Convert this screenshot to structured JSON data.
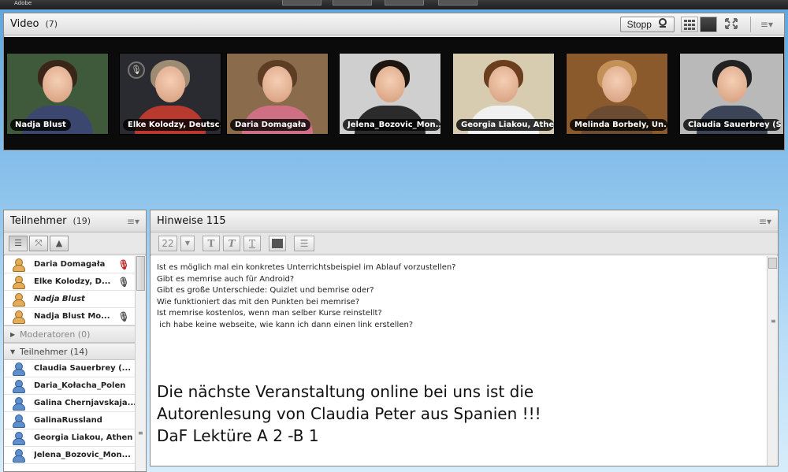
{
  "app": {
    "logo_text": "Adobe"
  },
  "video_pod": {
    "title": "Video",
    "count": "(7)",
    "stop_label": "Stopp",
    "tiles": [
      {
        "name": "Nadja Blust",
        "bg": "#3f5a3b",
        "hair": "#3a2619",
        "body": "#3c4770"
      },
      {
        "name": "Elke Kolodzy, Deutsc...",
        "bg": "#2a2b30",
        "hair": "#9d8c73",
        "body": "#b83a2e"
      },
      {
        "name": "Daria Domagała",
        "bg": "#8a6b4c",
        "hair": "#5e3d25",
        "body": "#cf6f83"
      },
      {
        "name": "Jelena_Bozovic_Mon...",
        "bg": "#cfcfcf",
        "hair": "#1d1510",
        "body": "#2b2b2b"
      },
      {
        "name": "Georgia Liakou, Athen",
        "bg": "#d8ccb0",
        "hair": "#6a3e1f",
        "body": "#f0f0f0"
      },
      {
        "name": "Melinda Borbely, Un...",
        "bg": "#8a5a2c",
        "hair": "#c39057",
        "body": "#6c4b33"
      },
      {
        "name": "Claudia Sauerbrey (S...",
        "bg": "#b9b9b9",
        "hair": "#222222",
        "body": "#3b4557"
      }
    ]
  },
  "attendees_pod": {
    "title": "Teilnehmer",
    "count": "(19)",
    "hosts": [
      {
        "name": "Daria Domagała",
        "mic": "muted"
      },
      {
        "name": "Elke Kolodzy, D...",
        "mic": "on"
      },
      {
        "name": "Nadja Blust",
        "mic": "",
        "italic": true
      },
      {
        "name": "Nadja Blust Mo...",
        "mic": "on"
      }
    ],
    "moderators_label": "Moderatoren (0)",
    "participants_label": "Teilnehmer (14)",
    "participants": [
      "Claudia Sauerbrey (...",
      "Daria_Kołacha_Polen",
      "Galina Chernjavskaja...",
      "GalinaRussland",
      "Georgia Liakou, Athen",
      "Jelena_Bozovic_Mon..."
    ]
  },
  "notes_pod": {
    "title": "Hinweise 115",
    "font_size": "22",
    "questions": [
      "Ist es möglich mal ein konkretes Unterrichtsbeispiel im Ablauf vorzustellen?",
      "Gibt es memrise auch für Android?",
      "Gibt es große Unterschiede: Quizlet und bemrise oder?",
      "Wie funktioniert das mit den Punkten bei memrise?",
      "Ist memrise kostenlos, wenn man selber Kurse reinstellt?",
      " ich habe keine webseite, wie kann ich dann einen link erstellen?"
    ],
    "announcement": [
      "Die nächste Veranstaltung online bei uns ist die",
      "Autorenlesung von Claudia Peter aus Spanien !!!",
      "DaF Lektüre A 2 -B 1"
    ]
  }
}
